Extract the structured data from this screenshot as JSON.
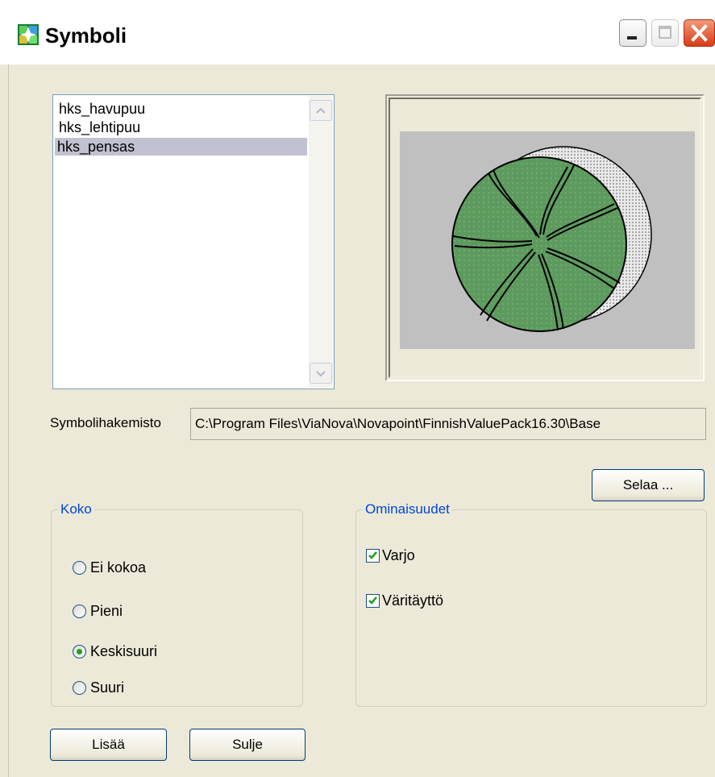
{
  "window": {
    "title": "Symboli"
  },
  "symbol_list": {
    "items": [
      "hks_havupuu",
      "hks_lehtipuu",
      "hks_pensas"
    ],
    "selected": "hks_pensas"
  },
  "directory": {
    "label": "Symbolihakemisto",
    "value": "C:\\Program Files\\ViaNova\\Novapoint\\FinnishValuePack16.30\\Base"
  },
  "buttons": {
    "browse": "Selaa ...",
    "add": "Lisää",
    "close": "Sulje"
  },
  "size_group": {
    "title": "Koko",
    "options": [
      "Ei kokoa",
      "Pieni",
      "Keskisuuri",
      "Suuri"
    ],
    "selected": "Keskisuuri"
  },
  "properties_group": {
    "title": "Ominaisuudet",
    "options": [
      {
        "label": "Varjo",
        "checked": true
      },
      {
        "label": "Väritäyttö",
        "checked": true
      }
    ]
  },
  "colors": {
    "accent": "#0046d5",
    "dialog_bg": "#ece9d8",
    "symbol_fill": "#5d9a5d",
    "selection": "#c1c1d1"
  }
}
